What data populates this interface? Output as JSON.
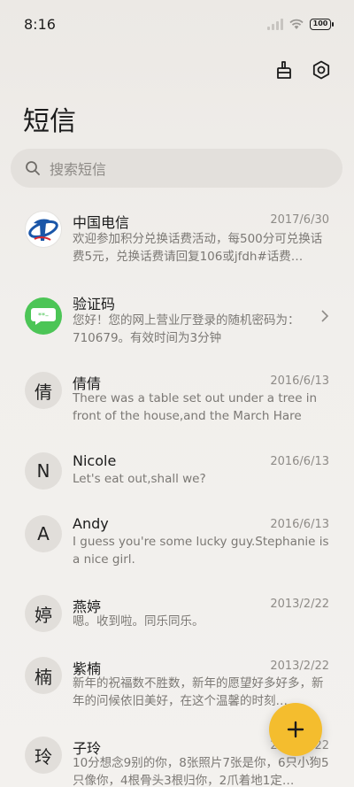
{
  "status": {
    "time": "8:16",
    "battery": "100"
  },
  "header": {
    "title": "短信"
  },
  "search": {
    "placeholder": "搜索短信"
  },
  "conversations": [
    {
      "name": "中国电信",
      "date": "2017/6/30",
      "preview": "欢迎参加积分兑换话费活动，每500分可兑换话费5元，兑换话费请回复106或jfdh#话费…",
      "avatar_type": "telecom-logo"
    },
    {
      "name": "验证码",
      "date": "",
      "preview": "您好！您的网上营业厅登录的随机密码为：710679。有效时间为3分钟",
      "avatar_type": "code-icon"
    },
    {
      "name": "倩倩",
      "date": "2016/6/13",
      "preview": "There was a table set out under a tree in front of the house,and the March Hare an…",
      "avatar_char": "倩"
    },
    {
      "name": "Nicole",
      "date": "2016/6/13",
      "preview": "Let's eat out,shall we?",
      "avatar_char": "N"
    },
    {
      "name": "Andy",
      "date": "2016/6/13",
      "preview": "I guess you're some lucky guy.Stephanie is a nice girl.",
      "avatar_char": "A"
    },
    {
      "name": "燕婷",
      "date": "2013/2/22",
      "preview": "嗯。收到啦。同乐同乐。",
      "avatar_char": "婷"
    },
    {
      "name": "紫楠",
      "date": "2013/2/22",
      "preview": "新年的祝福数不胜数，新年的愿望好多好多，新年的问候依旧美好，在这个温馨的时刻…",
      "avatar_char": "楠"
    },
    {
      "name": "子玲",
      "date": "2013/2/22",
      "preview": "10分想念9别的你，8张照片7张是你，6只小狗5只像你，4根骨头3根归你，2爪着地1定…",
      "avatar_char": "玲"
    }
  ],
  "colors": {
    "fab": "#f4bd2e",
    "telecom_blue": "#1a56a8",
    "code_green": "#4cc556"
  }
}
